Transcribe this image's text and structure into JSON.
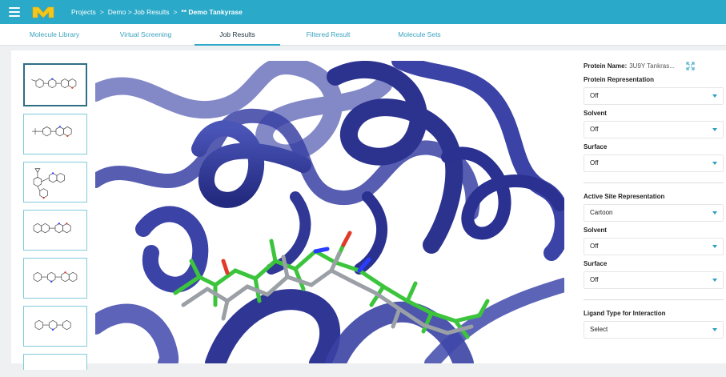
{
  "header": {
    "breadcrumb": [
      "Projects",
      ">",
      "Demo > Job Results",
      ">",
      "** Demo Tankyrase"
    ]
  },
  "tabs": [
    {
      "label": "Molecule Library"
    },
    {
      "label": "Virtual Screening"
    },
    {
      "label": "Job Results"
    },
    {
      "label": "Filtered Result"
    },
    {
      "label": "Molecule Sets"
    }
  ],
  "active_tab": "Job Results",
  "panel": {
    "protein_name_label": "Protein Name:",
    "protein_name_value": "3U9Y Tankras...",
    "fields": [
      {
        "label": "Protein Representation",
        "value": "Off"
      },
      {
        "label": "Solvent",
        "value": "Off"
      },
      {
        "label": "Surface",
        "value": "Off"
      },
      {
        "label": "Active Site Representation",
        "value": "Cartoon"
      },
      {
        "label": "Solvent",
        "value": "Off"
      },
      {
        "label": "Surface",
        "value": "Off"
      },
      {
        "label": "Ligand Type for Interaction",
        "value": "Select"
      }
    ]
  },
  "colors": {
    "header": "#2aa9c9",
    "accent": "#2a9fc2",
    "protein_ribbon": "#34399a",
    "ligand_green": "#3cc43c",
    "ligand_grey": "#9aa0a6",
    "nitrogen": "#2a3cff",
    "oxygen": "#e03a2a"
  },
  "icons": [
    "menu-icon",
    "app-logo",
    "expand-icon",
    "chevron-down-icon"
  ]
}
